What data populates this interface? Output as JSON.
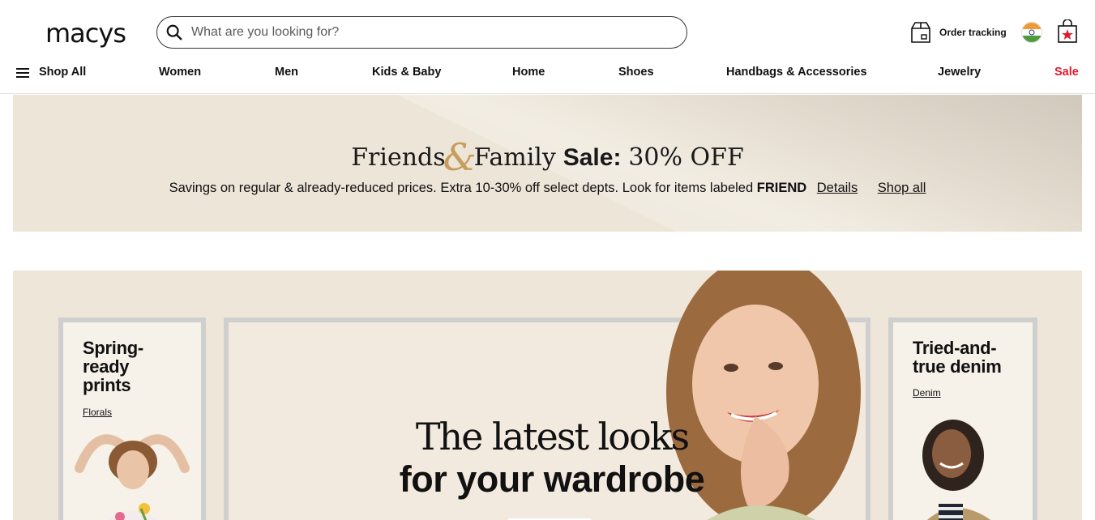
{
  "brand": {
    "logo": "macys"
  },
  "search": {
    "placeholder": "What are you looking for?"
  },
  "header": {
    "order_tracking": "Order tracking",
    "country_flag_icon": "india-flag-icon",
    "bag_icon": "shopping-bag-star-icon"
  },
  "nav": {
    "shop_all": "Shop All",
    "items": [
      "Women",
      "Men",
      "Kids & Baby",
      "Home",
      "Shoes",
      "Handbags & Accessories",
      "Jewelry",
      "Sale"
    ]
  },
  "promo": {
    "friends": "Friends",
    "amp": "&",
    "family": "Family",
    "sale": "Sale:",
    "offer": "30% OFF",
    "sub_text": "Savings on regular & already-reduced prices. Extra 10-30% off select depts. Look for items labeled",
    "sub_bold": "FRIEND",
    "details_link": "Details",
    "shop_all_link": "Shop all"
  },
  "hero": {
    "left_card": {
      "title_line1": "Spring-",
      "title_line2": "ready",
      "title_line3": "prints",
      "link": "Florals"
    },
    "main_card": {
      "line1": "The latest looks",
      "line2": "for your wardrobe"
    },
    "right_card": {
      "title_line1": "Tried-and-",
      "title_line2": "true denim",
      "link": "Denim"
    }
  },
  "colors": {
    "sale_red": "#e21a2c",
    "banner_beige": "#ece5d8",
    "hero_beige": "#efe6da"
  }
}
